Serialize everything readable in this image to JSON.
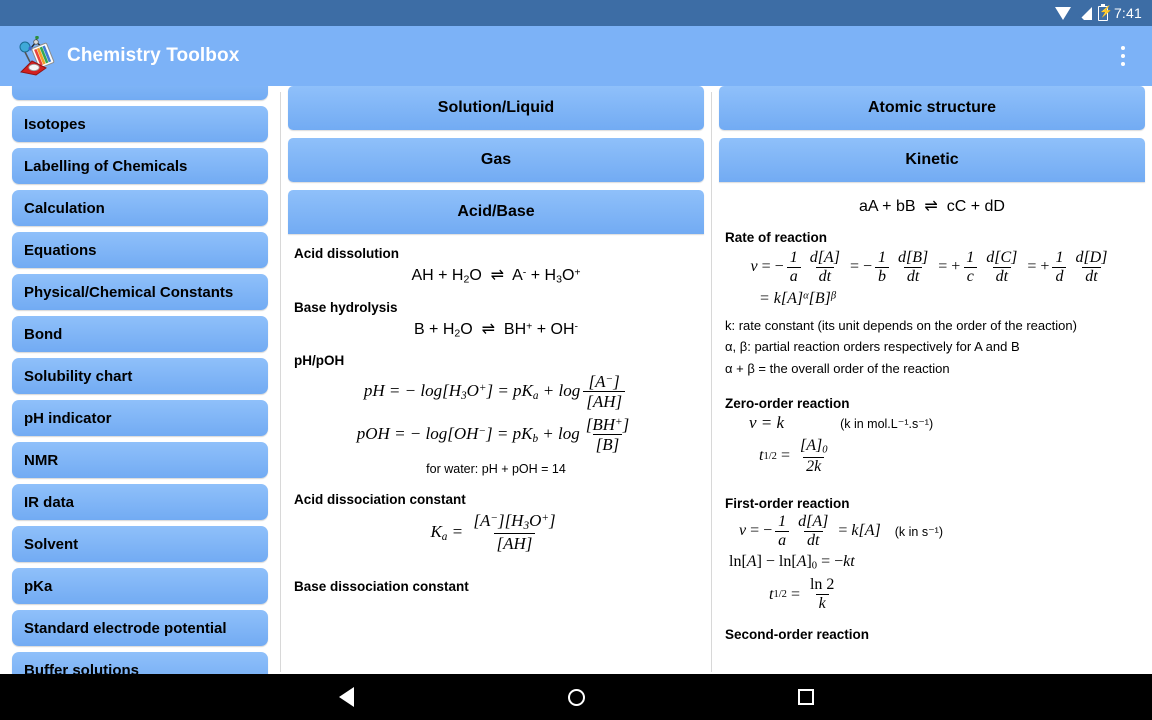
{
  "status_bar": {
    "time": "7:41",
    "icons": [
      "wifi-icon",
      "signal-icon",
      "battery-charging-icon"
    ]
  },
  "app_bar": {
    "title": "Chemistry Toolbox",
    "logo_icon": "chemistry-toolbox-logo-icon",
    "overflow_icon": "overflow-menu-icon",
    "background_color": "#7cb2f7"
  },
  "sidebar": {
    "items": [
      {
        "label": "Isotopes"
      },
      {
        "label": "Labelling of Chemicals"
      },
      {
        "label": "Calculation"
      },
      {
        "label": "Equations"
      },
      {
        "label": "Physical/Chemical Constants"
      },
      {
        "label": "Bond"
      },
      {
        "label": "Solubility chart"
      },
      {
        "label": "pH indicator"
      },
      {
        "label": "NMR"
      },
      {
        "label": "IR data"
      },
      {
        "label": "Solvent"
      },
      {
        "label": "pKa"
      },
      {
        "label": "Standard electrode potential"
      },
      {
        "label": "Buffer solutions"
      }
    ]
  },
  "middle_column": {
    "headers": [
      {
        "label": "Solution/Liquid"
      },
      {
        "label": "Gas"
      },
      {
        "label": "Acid/Base"
      }
    ],
    "acid_base": {
      "acid_dissolution": {
        "title": "Acid dissolution",
        "equation": "AH + H2O ⇌ A⁻ + H3O⁺"
      },
      "base_hydrolysis": {
        "title": "Base hydrolysis",
        "equation": "B + H2O ⇌ BH⁺ + OH⁻"
      },
      "ph_poh": {
        "title": "pH/pOH",
        "ph_equation": "pH = − log[H3O⁺] = pKa + log [A⁻]/[AH]",
        "poh_equation": "pOH = − log[OH⁻] = pKb + log [BH⁺]/[B]",
        "water_note": "for water:   pH + pOH = 14"
      },
      "acid_dissociation_constant": {
        "title": "Acid dissociation constant",
        "equation": "Ka = [A⁻][H3O⁺] / [AH]"
      },
      "base_dissociation_constant": {
        "title": "Base dissociation constant"
      }
    }
  },
  "right_column": {
    "headers": [
      {
        "label": "Atomic structure"
      },
      {
        "label": "Kinetic"
      }
    ],
    "kinetic": {
      "general_equation": "aA + bB ⇌ cC + dD",
      "rate_of_reaction": {
        "title": "Rate of reaction",
        "equation_line1": "v = − (1/a) d[A]/dt = − (1/b) d[B]/dt = + (1/c) d[C]/dt = + (1/d) d[D]/dt",
        "equation_line2": "= k[A]α[B]β",
        "notes": [
          "k: rate constant (its unit depends on the order of the reaction)",
          "α, β: partial reaction orders respectively for A and B",
          "α + β = the overall order of the reaction"
        ]
      },
      "zero_order": {
        "title": "Zero-order reaction",
        "rate_equation": "v = k",
        "unit_note": "(k in mol.L⁻¹.s⁻¹)",
        "half_life": "t1/2 = [A]0 / 2k"
      },
      "first_order": {
        "title": "First-order reaction",
        "rate_equation": "v = − (1/a) d[A]/dt = k[A]",
        "unit_note": "(k in s⁻¹)",
        "integrated": "ln[A] − ln[A]0 = −kt",
        "half_life": "t1/2 = ln2 / k"
      },
      "second_order": {
        "title": "Second-order reaction"
      }
    }
  },
  "nav_bar": {
    "back_icon": "back-triangle-icon",
    "home_icon": "home-circle-icon",
    "recents_icon": "recents-square-icon"
  }
}
